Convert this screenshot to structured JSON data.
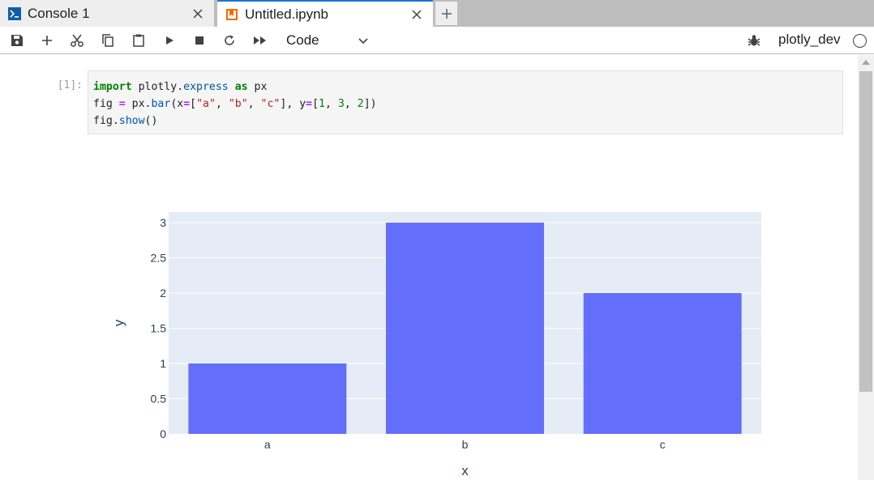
{
  "tabs": [
    {
      "label": "Console 1",
      "icon": "console-icon",
      "active": false
    },
    {
      "label": "Untitled.ipynb",
      "icon": "notebook-icon",
      "active": true
    }
  ],
  "toolbar": {
    "cell_type": "Code",
    "kernel_name": "plotly_dev",
    "buttons": [
      "save-icon",
      "add-cell-icon",
      "cut-icon",
      "copy-icon",
      "paste-icon",
      "run-icon",
      "stop-icon",
      "restart-icon",
      "run-all-icon"
    ]
  },
  "cell": {
    "prompt": "[1]:",
    "code_lines": [
      "import plotly.express as px",
      "fig = px.bar(x=[\"a\", \"b\", \"c\"], y=[1, 3, 2])",
      "fig.show()"
    ]
  },
  "colors": {
    "bar": "#636efa",
    "plot_bg": "#e5ecf6",
    "tab_active_border": "#1976d2",
    "keyword": "#008000",
    "string": "#ba2121",
    "operator": "#aa22ff"
  },
  "chart_data": {
    "type": "bar",
    "categories": [
      "a",
      "b",
      "c"
    ],
    "values": [
      1,
      3,
      2
    ],
    "xlabel": "x",
    "ylabel": "y",
    "ylim": [
      0,
      3.15
    ],
    "yticks": [
      0,
      0.5,
      1,
      1.5,
      2,
      2.5,
      3
    ],
    "ytick_labels": [
      "0",
      "0.5",
      "1",
      "1.5",
      "2",
      "2.5",
      "3"
    ],
    "grid": true
  }
}
